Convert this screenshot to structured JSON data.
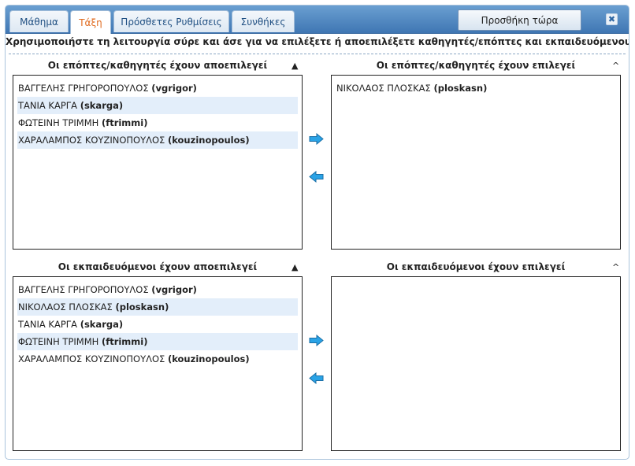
{
  "tabs": [
    {
      "label": "Μάθημα",
      "active": false
    },
    {
      "label": "Τάξη",
      "active": true
    },
    {
      "label": "Πρόσθετες Ρυθμίσεις",
      "active": false
    },
    {
      "label": "Συνθήκες",
      "active": false
    }
  ],
  "add_button_label": "Προσθήκη τώρα",
  "close_icon": "✖",
  "instructions": "Χρησιμοποιήστε τη λειτουργία σύρε και άσε για να επιλέξετε ή αποεπιλέξετε καθηγητές/επόπτες και εκπαιδευόμενους",
  "supervisors": {
    "deselected_title": "Οι επόπτες/καθηγητές έχουν αποεπιλεγεί",
    "selected_title": "Οι επόπτες/καθηγητές έχουν επιλεγεί",
    "deselected_sort": "▲",
    "selected_sort": "^",
    "deselected": [
      {
        "name": "ΒΑΓΓΕΛΗΣ ΓΡΗΓΟΡΟΠΟΥΛΟΣ",
        "username": "(vgrigor)"
      },
      {
        "name": "ΤΑΝΙΑ ΚΑΡΓΑ",
        "username": "(skarga)"
      },
      {
        "name": "ΦΩΤΕΙΝΗ ΤΡΙΜΜΗ",
        "username": "(ftrimmi)"
      },
      {
        "name": "ΧΑΡΑΛΑΜΠΟΣ ΚΟΥΖΙΝΟΠΟΥΛΟΣ",
        "username": "(kouzinopoulos)"
      }
    ],
    "selected": [
      {
        "name": "ΝΙΚΟΛΑΟΣ ΠΛΟΣΚΑΣ",
        "username": "(ploskasn)"
      }
    ]
  },
  "learners": {
    "deselected_title": "Οι εκπαιδευόμενοι έχουν αποεπιλεγεί",
    "selected_title": "Οι εκπαιδευόμενοι έχουν επιλεγεί",
    "deselected_sort": "▲",
    "selected_sort": "^",
    "deselected": [
      {
        "name": "ΒΑΓΓΕΛΗΣ ΓΡΗΓΟΡΟΠΟΥΛΟΣ",
        "username": "(vgrigor)"
      },
      {
        "name": "ΝΙΚΟΛΑΟΣ ΠΛΟΣΚΑΣ",
        "username": "(ploskasn)"
      },
      {
        "name": "ΤΑΝΙΑ ΚΑΡΓΑ",
        "username": "(skarga)"
      },
      {
        "name": "ΦΩΤΕΙΝΗ ΤΡΙΜΜΗ",
        "username": "(ftrimmi)"
      },
      {
        "name": "ΧΑΡΑΛΑΜΠΟΣ ΚΟΥΖΙΝΟΠΟΥΛΟΣ",
        "username": "(kouzinopoulos)"
      }
    ],
    "selected": []
  },
  "colors": {
    "header_top": "#6a9fd1",
    "header_bottom": "#3f76b3",
    "active_tab_text": "#e06a1e",
    "tab_text": "#1f4f82",
    "row_highlight": "#e3eefa",
    "arrow_fill": "#2aa3e6"
  },
  "icons": {
    "move_right": "arrow-right-icon",
    "move_left": "arrow-left-icon",
    "close": "close-icon"
  }
}
